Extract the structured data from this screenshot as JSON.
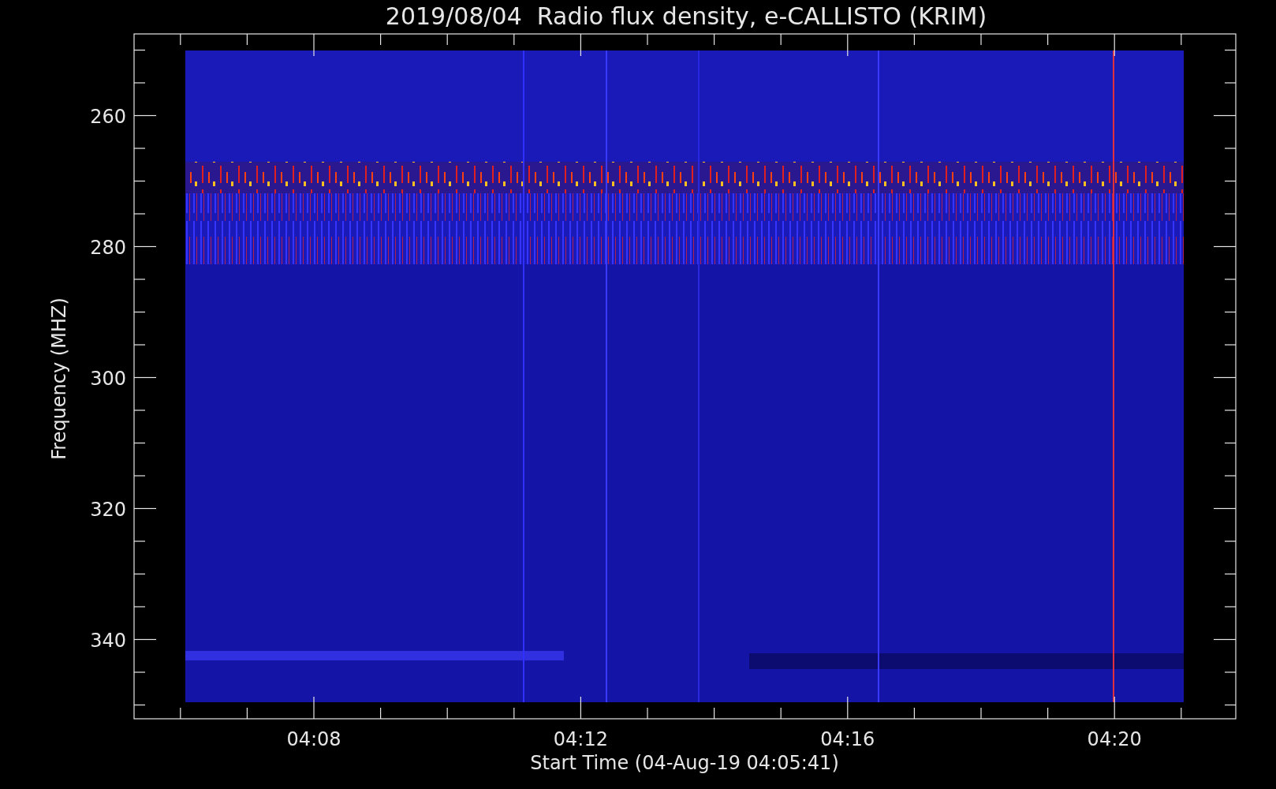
{
  "title": "2019/08/04  Radio flux density, e-CALLISTO (KRIM)",
  "ylabel": "Frequency (MHZ)",
  "xlabel": "Start Time (04-Aug-19 04:05:41)",
  "yticks": [
    "260",
    "280",
    "300",
    "320",
    "340"
  ],
  "xticks": [
    "04:08",
    "04:12",
    "04:16",
    "04:20"
  ]
}
